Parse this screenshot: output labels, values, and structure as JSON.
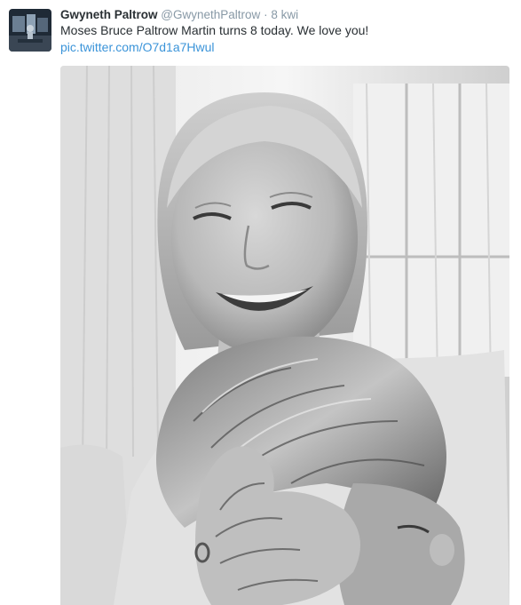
{
  "tweet": {
    "fullname": "Gwyneth Paltrow",
    "username": "@GwynethPaltrow",
    "separator": "·",
    "time": "8 kwi",
    "text": "Moses Bruce Paltrow Martin turns 8 today. We love you!",
    "link": "pic.twitter.com/O7d1a7Hwul"
  },
  "colors": {
    "name": "#292f33",
    "meta": "#8899a6",
    "link": "#3b94d9"
  }
}
